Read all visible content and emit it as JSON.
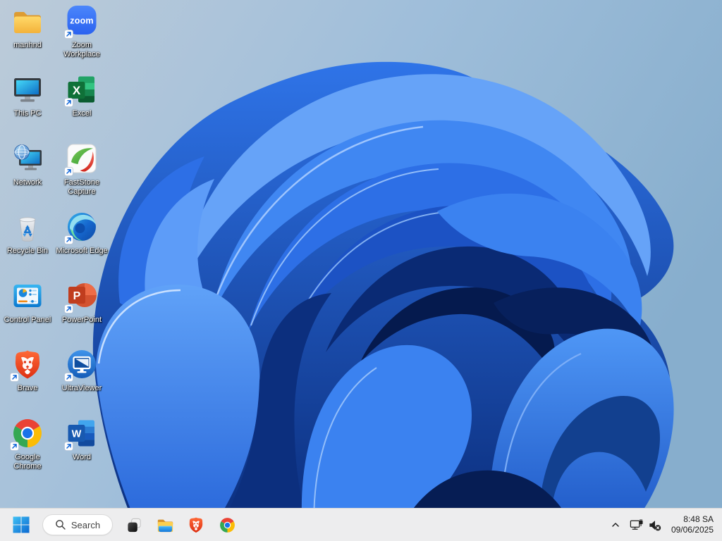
{
  "desktop": {
    "icons": [
      {
        "label": "manhnd",
        "type": "folder-icon",
        "shortcut": false
      },
      {
        "label": "Zoom Workplace",
        "type": "zoom-app-icon",
        "shortcut": true
      },
      {
        "label": "This PC",
        "type": "this-pc-icon",
        "shortcut": false
      },
      {
        "label": "Excel",
        "type": "excel-icon",
        "shortcut": true
      },
      {
        "label": "Network",
        "type": "network-icon",
        "shortcut": false
      },
      {
        "label": "FastStone Capture",
        "type": "faststone-icon",
        "shortcut": true
      },
      {
        "label": "Recycle Bin",
        "type": "recycle-bin-icon",
        "shortcut": false
      },
      {
        "label": "Microsoft Edge",
        "type": "edge-icon",
        "shortcut": true
      },
      {
        "label": "Control Panel",
        "type": "control-panel-icon",
        "shortcut": false
      },
      {
        "label": "PowerPoint",
        "type": "powerpoint-icon",
        "shortcut": true
      },
      {
        "label": "Brave",
        "type": "brave-icon",
        "shortcut": true
      },
      {
        "label": "UltraViewer",
        "type": "ultraviewer-icon",
        "shortcut": true
      },
      {
        "label": "Google Chrome",
        "type": "chrome-icon",
        "shortcut": true
      },
      {
        "label": "Word",
        "type": "word-icon",
        "shortcut": true
      }
    ],
    "letters": {
      "zoom": "zoom",
      "excel": "X",
      "powerpoint": "P",
      "word": "W"
    }
  },
  "taskbar": {
    "search": {
      "label": "Search"
    },
    "pinned": [
      {
        "name": "start-button"
      },
      {
        "name": "task-view"
      },
      {
        "name": "file-explorer"
      },
      {
        "name": "brave"
      },
      {
        "name": "chrome"
      }
    ]
  },
  "tray": {
    "icons": [
      "chevron-up-icon",
      "network-ethernet-icon",
      "volume-muted-icon"
    ],
    "time": "8:48 SA",
    "date": "09/06/2025"
  },
  "colors": {
    "taskbar_bg": "#ededee",
    "sky_light": "#bccbd9",
    "sky_dark": "#87aecd",
    "bloom_bright": "#3f86f4",
    "bloom_dark": "#051a4e",
    "accent_blue": "#1266d8"
  }
}
